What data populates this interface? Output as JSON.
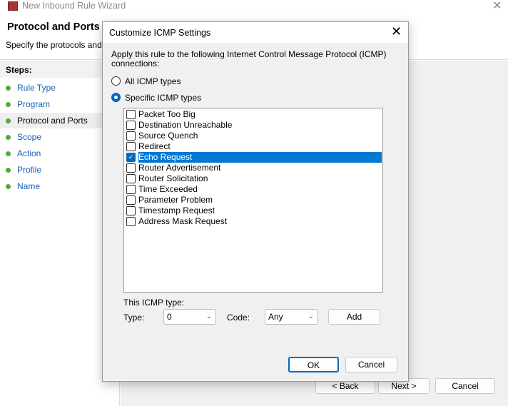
{
  "window": {
    "title": "New Inbound Rule Wizard",
    "close": "✕"
  },
  "header": {
    "title": "Protocol and Ports",
    "subtitle": "Specify the protocols and po"
  },
  "steps": {
    "label": "Steps:",
    "items": [
      "Rule Type",
      "Program",
      "Protocol and Ports",
      "Scope",
      "Action",
      "Profile",
      "Name"
    ],
    "current": 2
  },
  "footer": {
    "back": "< Back",
    "next": "Next >",
    "cancel": "Cancel"
  },
  "dialog": {
    "title": "Customize ICMP Settings",
    "close": "✕",
    "description": "Apply this rule to the following Internet Control Message Protocol (ICMP) connections:",
    "radio_all": "All ICMP types",
    "radio_specific": "Specific ICMP types",
    "selected_radio": "specific",
    "icmp_types": [
      {
        "label": "Packet Too Big",
        "checked": false
      },
      {
        "label": "Destination Unreachable",
        "checked": false
      },
      {
        "label": "Source Quench",
        "checked": false
      },
      {
        "label": "Redirect",
        "checked": false
      },
      {
        "label": "Echo Request",
        "checked": true,
        "selected": true
      },
      {
        "label": "Router Advertisement",
        "checked": false
      },
      {
        "label": "Router Solicitation",
        "checked": false
      },
      {
        "label": "Time Exceeded",
        "checked": false
      },
      {
        "label": "Parameter Problem",
        "checked": false
      },
      {
        "label": "Timestamp Request",
        "checked": false
      },
      {
        "label": "Address Mask Request",
        "checked": false
      }
    ],
    "this_type_label": "This ICMP type:",
    "type_label": "Type:",
    "type_value": "0",
    "code_label": "Code:",
    "code_value": "Any",
    "add": "Add",
    "ok": "OK",
    "cancel": "Cancel"
  }
}
